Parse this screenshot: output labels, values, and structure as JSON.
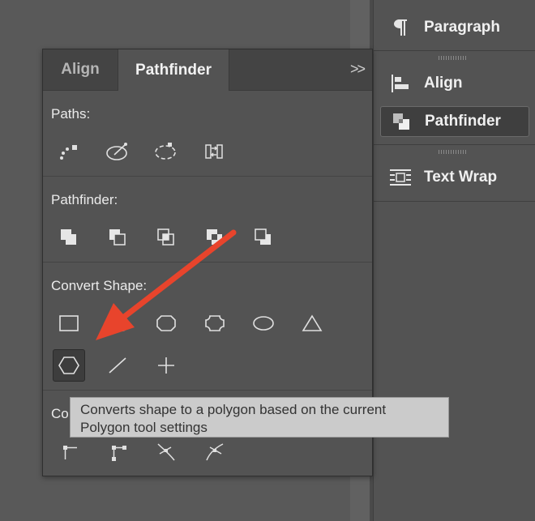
{
  "dock": {
    "items": [
      {
        "label": "Paragraph",
        "icon": "paragraph-icon"
      },
      {
        "label": "Align",
        "icon": "align-icon"
      },
      {
        "label": "Pathfinder",
        "icon": "pathfinder-icon"
      },
      {
        "label": "Text Wrap",
        "icon": "text-wrap-icon"
      }
    ]
  },
  "panel": {
    "tabs": [
      {
        "label": "Align"
      },
      {
        "label": "Pathfinder"
      }
    ],
    "menu_glyph": ">>",
    "sections": {
      "paths": "Paths:",
      "pathfinder": "Pathfinder:",
      "convert_shape": "Convert Shape:",
      "convert_point": "Co"
    }
  },
  "tooltip": {
    "line1": "Converts shape to a polygon based on the current",
    "line2": "Polygon tool settings"
  },
  "colors": {
    "annotation_arrow": "#e8442c"
  }
}
